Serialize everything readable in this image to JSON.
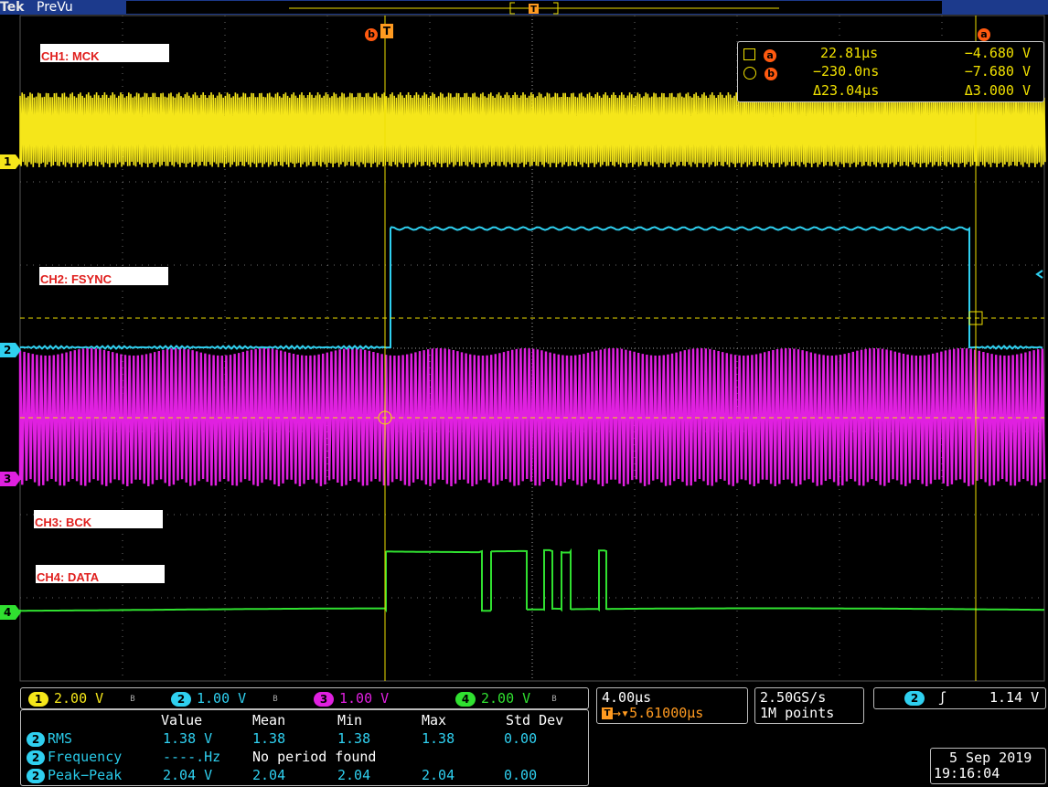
{
  "header": {
    "brand": "Tek",
    "mode": "PreVu"
  },
  "channel_labels": {
    "ch1": "CH1: MCK",
    "ch2": "CH2: FSYNC",
    "ch3": "CH3: BCK",
    "ch4": "CH4: DATA"
  },
  "ground_markers": [
    "1",
    "2",
    "3",
    "4"
  ],
  "trigger_marker": "T",
  "cursor_marker_a": "a",
  "cursor_marker_b": "b",
  "cursors": {
    "a": {
      "time": "22.81µs",
      "volt": "−4.680 V"
    },
    "b": {
      "time": "−230.0ns",
      "volt": "−7.680 V"
    },
    "delta": {
      "time": "Δ23.04µs",
      "volt": "Δ3.000 V"
    }
  },
  "channels": [
    {
      "num": "1",
      "scale": "2.00 V",
      "color": "#f5e61a"
    },
    {
      "num": "2",
      "scale": "1.00 V",
      "color": "#2fd0f0"
    },
    {
      "num": "3",
      "scale": "1.00 V",
      "color": "#e020e0"
    },
    {
      "num": "4",
      "scale": "2.00 V",
      "color": "#30e030"
    }
  ],
  "measurements": {
    "headers": [
      "Value",
      "Mean",
      "Min",
      "Max",
      "Std Dev"
    ],
    "rows": [
      {
        "ch": "2",
        "name": "RMS",
        "value": "1.38 V",
        "mean": "1.38",
        "min": "1.38",
        "max": "1.38",
        "std": "0.00"
      },
      {
        "ch": "2",
        "name": "Frequency",
        "value": "----.Hz",
        "note": "No period found"
      },
      {
        "ch": "2",
        "name": "Peak−Peak",
        "value": "2.04 V",
        "mean": "2.04",
        "min": "2.04",
        "max": "2.04",
        "std": "0.00"
      }
    ]
  },
  "horizontal": {
    "scale": "4.00µs",
    "position": "5.61000µs"
  },
  "acquisition": {
    "rate": "2.50GS/s",
    "record": "1M points"
  },
  "trigger": {
    "source": "2",
    "level": "1.14 V"
  },
  "datetime": {
    "date": "5 Sep  2019",
    "time": "19:16:04"
  },
  "colors": {
    "accent": "#1c3a8c",
    "grid": "#9a9a9a",
    "cursor": "#f0e000"
  }
}
